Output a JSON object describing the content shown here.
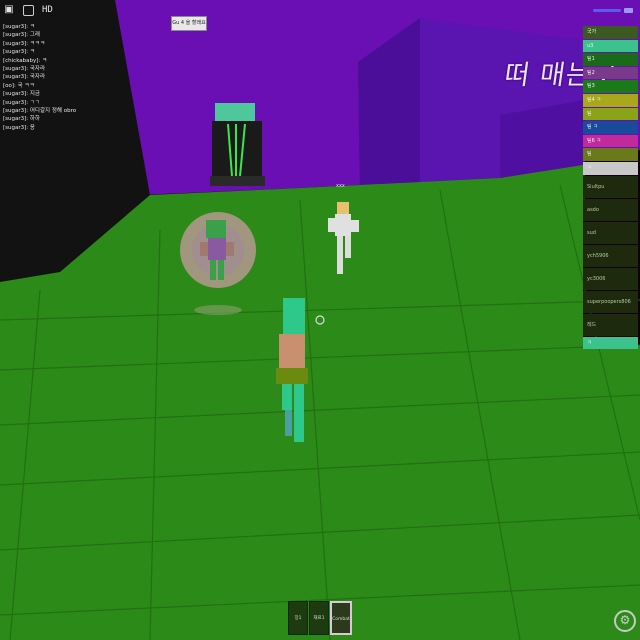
{
  "hud": {
    "menu_icon": "roblox-menu-icon",
    "chat_icon": "chat-bubble-icon",
    "quality_label": "HD"
  },
  "chat": [
    "[sugar3]: ㅋ",
    "[sugar3]: 그래",
    "[sugar3]: ㅋㅋㅋ",
    "[sugar3]: ㅋ",
    "[chickababy]: ㅋ",
    "[sugar3]: 국자라",
    "[sugar3]: 국자라",
    "[oo]: 국 ㅋㅋ",
    "[sugar3]: 지금",
    "[sugar3]: ㄱㄱ",
    "[sugar3]: 어디갈지 정해 obro",
    "[sugar3]: 하하",
    "[sugar3]: 응"
  ],
  "world": {
    "sign_text": "Gu 4 을 할래요",
    "wall_text": "떠 매는곳",
    "npc_tag": "xxx"
  },
  "player_list": {
    "small_rows": [
      {
        "label": "국가",
        "color": "#3a5a22"
      },
      {
        "label": "u3",
        "color": "#3cc28c"
      },
      {
        "label": "팀1",
        "color": "#1a6a1a"
      },
      {
        "label": "팀2",
        "color": "#7a3a8a"
      },
      {
        "label": "팀3",
        "color": "#1a7a1a"
      },
      {
        "label": "팀4 ㅋ",
        "color": "#a8a81a"
      },
      {
        "label": "팀",
        "color": "#8aa41a"
      },
      {
        "label": "팀 ㅋ",
        "color": "#1a4a9a"
      },
      {
        "label": "팀6 ㅋ",
        "color": "#c02a9a"
      },
      {
        "label": "팀",
        "color": "#6a7a1a"
      },
      {
        "label": "ㅋ",
        "color": "#c8c8c8"
      }
    ],
    "big_rows": [
      "Siultpu",
      "asdo",
      "sud",
      "ych5906",
      "yc3006",
      "superpoopers806",
      "레드"
    ],
    "bottom_rows": [
      {
        "label": "ㅋ",
        "color": "#3cc28c"
      }
    ]
  },
  "hotbar": [
    {
      "label": "장1",
      "selected": false
    },
    {
      "label": "재료1",
      "selected": false
    },
    {
      "label": "Combat",
      "selected": true
    }
  ],
  "settings_icon": "settings-gear-icon"
}
